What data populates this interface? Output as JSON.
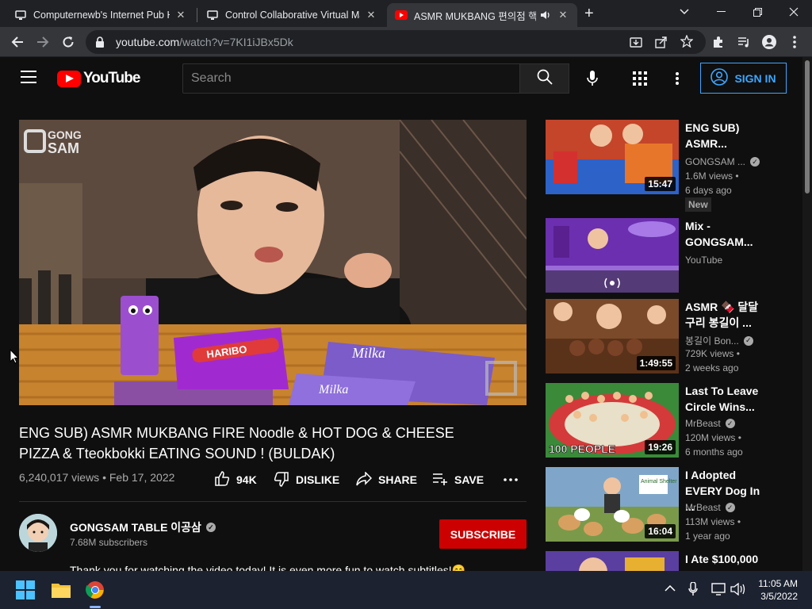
{
  "browser": {
    "tabs": [
      {
        "title": "Computernewb's Internet Pub Ho",
        "close": "✕"
      },
      {
        "title": "Control Collaborative Virtual Mac",
        "close": "✕"
      },
      {
        "title": "ASMR MUKBANG 편의점 핵",
        "close": "✕",
        "active": true
      }
    ],
    "new_tab": "+",
    "url_host": "youtube.com",
    "url_path": "/watch?v=7KI1iJBx5Dk"
  },
  "youtube": {
    "logo_text": "YouTube",
    "search_placeholder": "Search",
    "sign_in": "SIGN IN",
    "brand_color": "#ff0000",
    "accent_color": "#3ea6ff"
  },
  "video": {
    "title": "ENG SUB) ASMR MUKBANG FIRE Noodle & HOT DOG & CHEESE PIZZA & Tteokbokki EATING SOUND ! (BULDAK)",
    "views": "6,240,017 views",
    "sep": "•",
    "date": "Feb 17, 2022",
    "likes": "94K",
    "dislike": "DISLIKE",
    "share": "SHARE",
    "save": "SAVE",
    "more": "•••",
    "watermark": "GONG\nSAM",
    "overlay_text": {
      "bag": "HARIBO",
      "choco1": "Milka",
      "choco2": "Milka"
    }
  },
  "channel": {
    "name": "GONGSAM TABLE 이공삼",
    "subscribers": "7.68M subscribers",
    "subscribe": "SUBSCRIBE",
    "description": "Thank you for watching the video today! It is even more fun to watch subtitles!😊"
  },
  "recommendations": [
    {
      "title": "ENG SUB) ASMR...",
      "channel": "GONGSAM ...",
      "verified": true,
      "views": "1.6M views",
      "age": "6 days ago",
      "duration": "15:47",
      "badge": "New",
      "bg": "#c44a2a"
    },
    {
      "title": "Mix - GONGSAM...",
      "channel": "YouTube",
      "verified": false,
      "views": "",
      "age": "",
      "duration": "",
      "badge": "",
      "bg": "#6a2fa8"
    },
    {
      "title": "ASMR 🍫 달달 구리 봉길이 ...",
      "channel": "봉길이 Bon...",
      "verified": true,
      "views": "729K views",
      "age": "2 weeks ago",
      "duration": "1:49:55",
      "badge": "",
      "bg": "#7a4a2a"
    },
    {
      "title": "Last To Leave Circle Wins...",
      "channel": "MrBeast",
      "verified": true,
      "views": "120M views",
      "age": "6 months ago",
      "duration": "19:26",
      "badge": "",
      "bg": "#2a8a3a",
      "thumb_text": "100 PEOPLE"
    },
    {
      "title": "I Adopted EVERY Dog In ...",
      "channel": "MrBeast",
      "verified": true,
      "views": "113M views",
      "age": "1 year ago",
      "duration": "16:04",
      "badge": "",
      "bg": "#8aa86a",
      "thumb_text": "Animal Shelter"
    },
    {
      "title": "I Ate $100,000",
      "channel": "",
      "verified": false,
      "views": "",
      "age": "",
      "duration": "",
      "badge": "",
      "bg": "#5a3fa0"
    }
  ],
  "taskbar": {
    "time": "11:05 AM",
    "date": "3/5/2022"
  }
}
